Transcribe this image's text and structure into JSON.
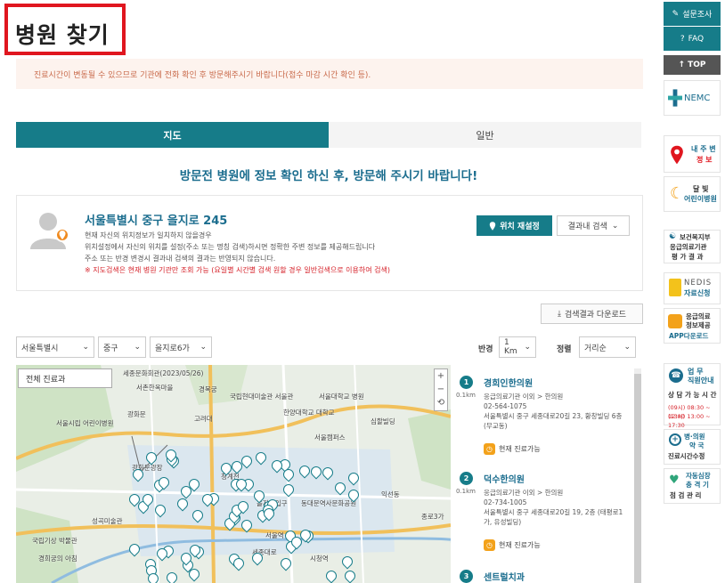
{
  "page": {
    "title": "병원 찾기",
    "notice": "진료시간이 변동될 수 있으므로 기관에 전화 확인 후 방문해주시기 바랍니다(접수 마감 시간 확인 등)."
  },
  "tabs": [
    {
      "label": "지도",
      "active": true
    },
    {
      "label": "일반",
      "active": false
    }
  ],
  "headline": "방문전 병원에 정보 확인 하신 후, 방문해 주시기 바랍니다!",
  "location": {
    "address": "서울특별시 중구 을지로 245",
    "lines": [
      "현재 자신의 위치정보가 일치하지 않을경우",
      "위치설정에서 자신의 위치를 설정(주소 또는 명칭 검색)하시면 정확한 주변 정보를 제공해드립니다",
      "주소 또는 반경 변경시 결과내 검색의 결과는 반영되지 않습니다."
    ],
    "warning": "※ 지도검색은 현재 병원 기관만 조회 가능 (요일별 시간별 검색 원할 경우 일반검색으로 이용하여 검색)",
    "reset_button": "위치 재설정",
    "search_within": "결과내 검색"
  },
  "download_button": "검색결과 다운로드",
  "filters": {
    "city": "서울특별시",
    "district": "중구",
    "dong": "을지로6가",
    "radius_label": "반경",
    "radius": "1 Km",
    "sort_label": "정렬",
    "sort": "거리순"
  },
  "map": {
    "category": "전체 진료과",
    "zoom_in": "+",
    "zoom_out": "−",
    "zoom_reset": "⟲",
    "place_labels": [
      "세종문화회관(2023/05/26)",
      "서촌한옥마을",
      "경복궁",
      "국립현대미술관 서울관",
      "서울대학교 병원",
      "한양대학교 대학교",
      "광화문",
      "고려대",
      "서울캠퍼스",
      "심할빌딩",
      "서울시립 어린이병원",
      "광화문광장",
      "청계천",
      "을지로입구",
      "동대문역사문화공원",
      "종로3가",
      "익선동",
      "성곡미술관",
      "국립기상 박물관",
      "경희궁의 아침",
      "서울역",
      "세종대로",
      "시청역"
    ]
  },
  "results": [
    {
      "number": "1",
      "distance": "0.1km",
      "name": "경희인한의원",
      "type": "응급의료기관 이외 > 한의원",
      "phone": "02-564-1075",
      "address": "서울특별시 중구 세종대로20길 23, 황창빌딩 6층 (무교동)",
      "status": "현재 진료가능"
    },
    {
      "number": "2",
      "distance": "0.1km",
      "name": "덕수한의원",
      "type": "응급의료기관 이외 > 한의원",
      "phone": "02-734-1005",
      "address": "서울특별시 중구 세종대로20길 19, 2층 (태평로1가, 유성빌딩)",
      "status": "현재 진료가능"
    },
    {
      "number": "3",
      "distance": "",
      "name": "센트럴치과",
      "type": "",
      "phone": "",
      "address": "",
      "status": ""
    }
  ],
  "sidebar": {
    "survey": "설문조사",
    "faq": "FAQ",
    "top": "TOP",
    "nemc": "NEMC",
    "nearby_title": "내 주 변",
    "nearby_sub": "정 보",
    "moonlight_title": "달 빛",
    "moonlight_sub": "어린이병원",
    "mohw_line1": "보건복지부",
    "mohw_line2": "응급의료기관",
    "mohw_line3": "평 가 결 과",
    "nedis_brand": "NEDIS",
    "nedis_sub": "자료신청",
    "app_line1": "응급의료",
    "app_line2": "정보제공",
    "app_line3": "APP다운로드",
    "work_title": "업 무",
    "work_sub": "직원안내",
    "consult_title": "상 담 가 능 시 간",
    "consult_line1": "(09시) 08:30 ~ 12:00",
    "consult_line2": "(13시) 13:00 ~ 17:30",
    "pharmacy_line1": "병·의원",
    "pharmacy_line2": "약 국",
    "pharmacy_line3": "진료시간수정",
    "selfcheck_line1": "자동심장",
    "selfcheck_line2": "충 격 기",
    "selfcheck_line3": "점 검 관 리"
  },
  "colors": {
    "accent": "#167c89",
    "title_border": "#e0161f",
    "headline": "#1b6d8e",
    "orange": "#f3a21b"
  }
}
